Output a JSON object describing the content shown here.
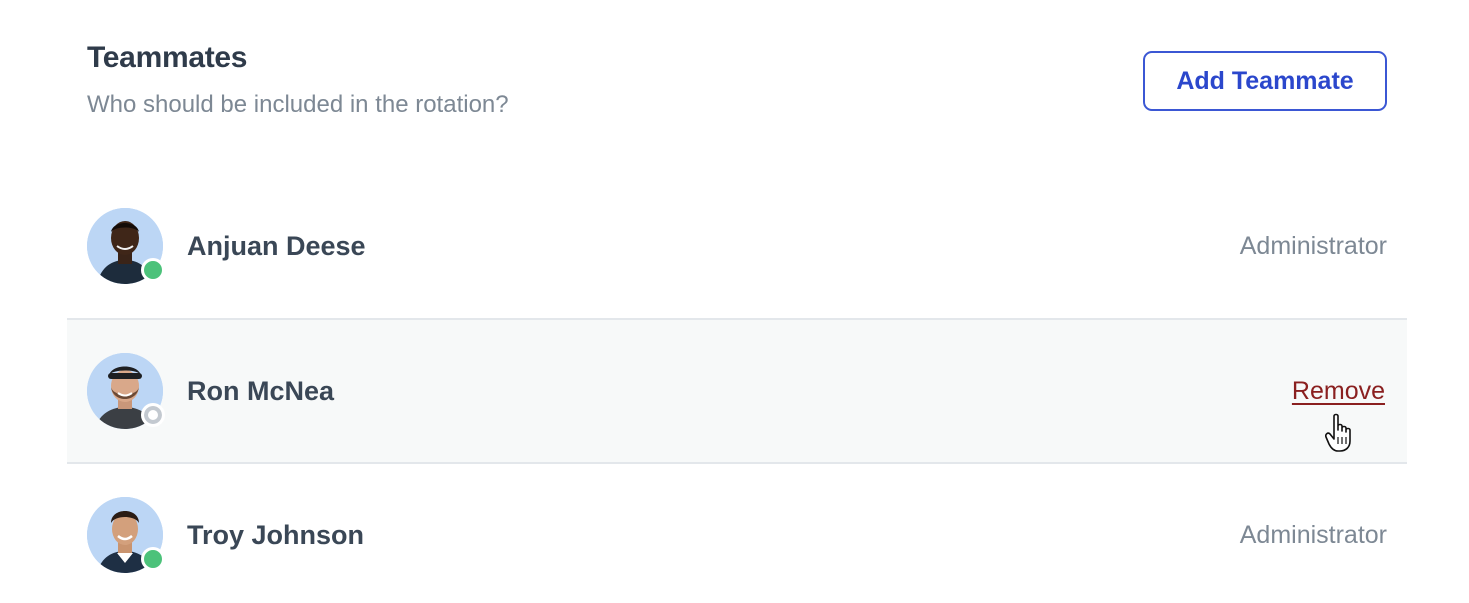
{
  "header": {
    "title": "Teammates",
    "subtitle": "Who should be included in the rotation?",
    "add_button_label": "Add Teammate"
  },
  "teammates": [
    {
      "name": "Anjuan Deese",
      "role": "Administrator",
      "status": "online"
    },
    {
      "name": "Ron McNea",
      "action": "Remove",
      "status": "offline"
    },
    {
      "name": "Troy Johnson",
      "role": "Administrator",
      "status": "online"
    }
  ],
  "colors": {
    "accent": "#3b57d4",
    "remove": "#8a2020",
    "online": "#4cc27a",
    "offline": "#c3c9d0"
  }
}
